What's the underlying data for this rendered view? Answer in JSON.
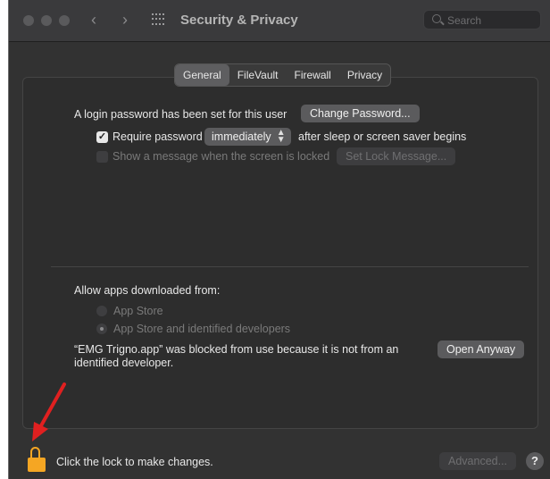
{
  "window": {
    "title": "Security & Privacy",
    "search_placeholder": "Search"
  },
  "tabs": [
    "General",
    "FileVault",
    "Firewall",
    "Privacy"
  ],
  "login": {
    "message": "A login password has been set for this user",
    "change_password": "Change Password..."
  },
  "require_password": {
    "checked": true,
    "label": "Require password",
    "selected": "immediately",
    "suffix": "after sleep or screen saver begins"
  },
  "lock_message": {
    "checked": false,
    "label": "Show a message when the screen is locked",
    "button": "Set Lock Message..."
  },
  "downloads": {
    "heading": "Allow apps downloaded from:",
    "options": [
      "App Store",
      "App Store and identified developers"
    ],
    "selected_index": 1,
    "blocked_line1": "“EMG Trigno.app” was blocked from use because it is not from an",
    "blocked_line2": "identified developer.",
    "open_anyway": "Open Anyway"
  },
  "footer": {
    "lock_text": "Click the lock to make changes.",
    "advanced": "Advanced...",
    "help": "?"
  },
  "colors": {
    "background": "#323232",
    "lock": "#f5a623",
    "annotation_arrow": "#e02020"
  },
  "icons": {
    "lock": "lock-icon",
    "grid": "show-all-grid-icon",
    "search": "search-icon",
    "back": "chevron-left-icon",
    "forward": "chevron-right-icon",
    "arrow": "red-arrow-annotation"
  }
}
